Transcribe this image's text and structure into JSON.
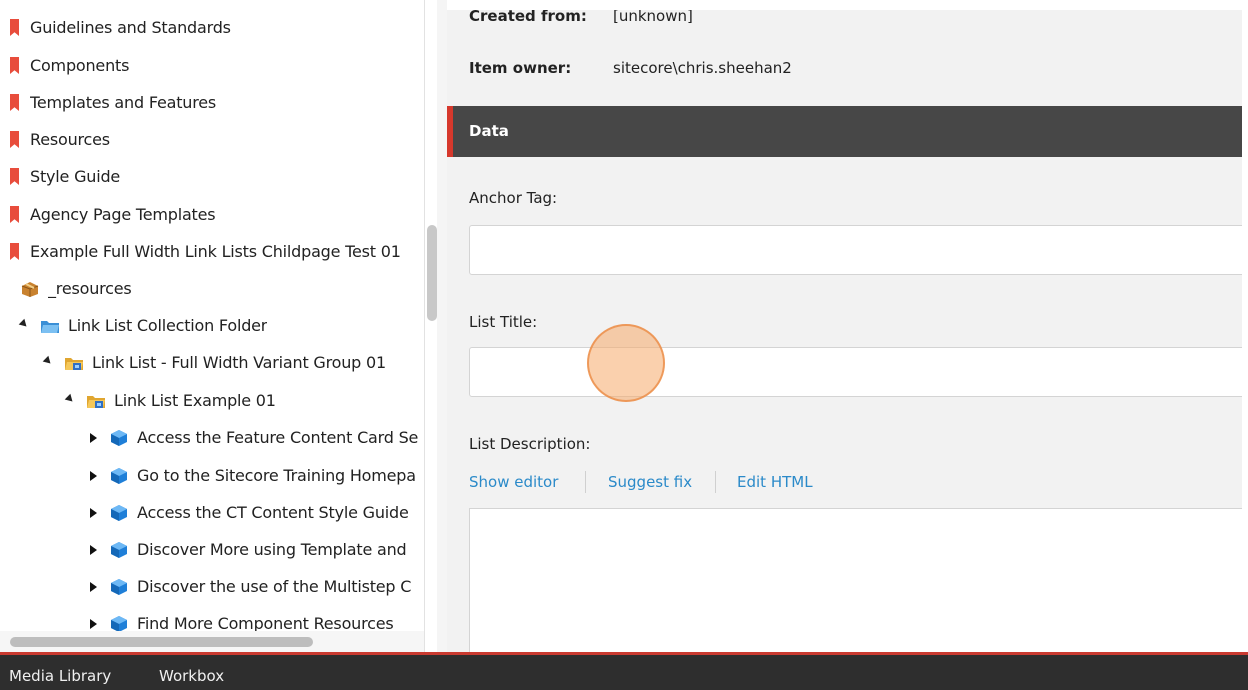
{
  "tree": {
    "items": [
      {
        "label": "Guidelines and Standards",
        "icon": "bookmark-icon"
      },
      {
        "label": "Components",
        "icon": "bookmark-icon"
      },
      {
        "label": "Templates and Features",
        "icon": "bookmark-icon"
      },
      {
        "label": "Resources",
        "icon": "bookmark-icon"
      },
      {
        "label": "Style Guide",
        "icon": "bookmark-icon"
      },
      {
        "label": "Agency Page Templates",
        "icon": "bookmark-icon"
      },
      {
        "label": "Example Full Width Link Lists Childpage Test 01",
        "icon": "bookmark-icon"
      },
      {
        "label": "_resources",
        "icon": "package-icon"
      },
      {
        "label": "Link List Collection Folder",
        "icon": "folder-icon",
        "expanded": true
      },
      {
        "label": "Link List - Full Width Variant Group 01",
        "icon": "folder-group-icon",
        "expanded": true
      },
      {
        "label": "Link List Example 01",
        "icon": "folder-group-icon",
        "expanded": true
      },
      {
        "label": "Access the Feature Content Card Se",
        "icon": "cube-icon",
        "expanded": false
      },
      {
        "label": "Go to the Sitecore Training Homepa",
        "icon": "cube-icon",
        "expanded": false
      },
      {
        "label": "Access the CT Content Style Guide",
        "icon": "cube-icon",
        "expanded": false
      },
      {
        "label": "Discover More using Template and",
        "icon": "cube-icon",
        "expanded": false
      },
      {
        "label": "Discover the use of the Multistep C",
        "icon": "cube-icon",
        "expanded": false
      },
      {
        "label": "Find More Component Resources",
        "icon": "cube-icon",
        "expanded": false
      }
    ]
  },
  "content": {
    "created_from_label": "Created from:",
    "created_from_value": "[unknown]",
    "item_owner_label": "Item owner:",
    "item_owner_value": "sitecore\\chris.sheehan2",
    "section_title": "Data",
    "fields": {
      "anchor_tag_label": "Anchor Tag:",
      "anchor_tag_value": "",
      "list_title_label": "List Title:",
      "list_title_value": "",
      "list_description_label": "List Description:"
    },
    "editor_links": {
      "show_editor": "Show editor",
      "suggest_fix": "Suggest fix",
      "edit_html": "Edit HTML"
    }
  },
  "bottom_bar": {
    "tabs": [
      "Media Library",
      "Workbox"
    ]
  },
  "colors": {
    "accent_red": "#d6382c",
    "section_header_bg": "#474747",
    "link_blue": "#2b8ac9",
    "bottom_bar_bg": "#2e2e2e",
    "bookmark_red": "#e84d3c"
  }
}
